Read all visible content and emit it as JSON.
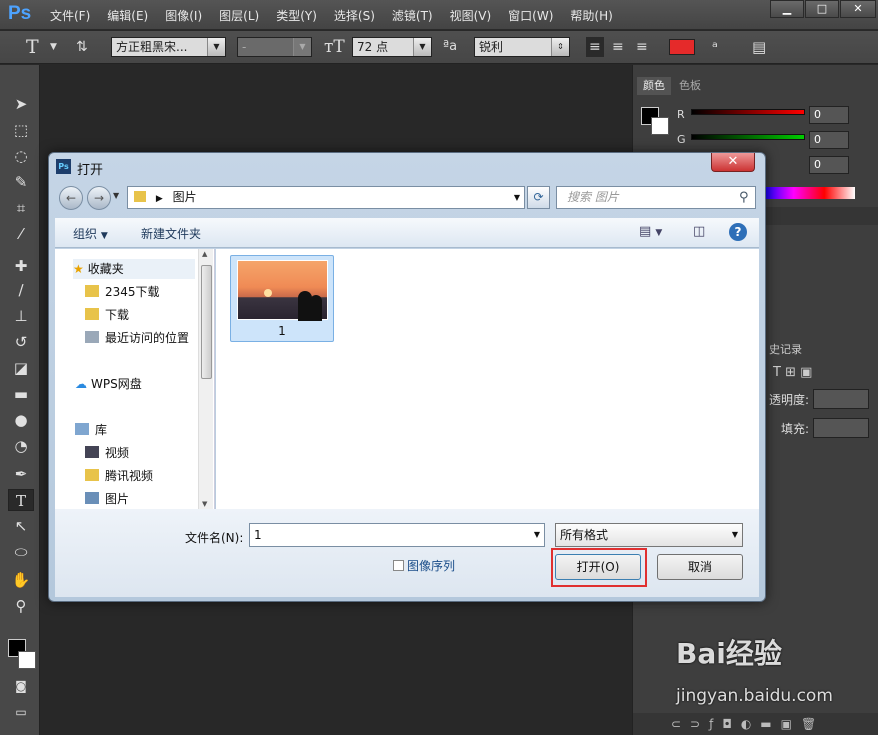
{
  "app": {
    "logo": "Ps"
  },
  "menubar": {
    "items": [
      "文件(F)",
      "编辑(E)",
      "图像(I)",
      "图层(L)",
      "类型(Y)",
      "选择(S)",
      "滤镜(T)",
      "视图(V)",
      "窗口(W)",
      "帮助(H)"
    ]
  },
  "window_buttons": {
    "minimize": "▁",
    "maximize": "□",
    "close": "✕"
  },
  "optionsbar": {
    "font_family": "方正粗黑宋...",
    "font_style": "-",
    "font_size": "72 点",
    "antialias": "锐利",
    "text_color": "#e52a2a"
  },
  "right_panel": {
    "tabs": [
      "颜色",
      "色板"
    ],
    "r_label": "R",
    "g_label": "G",
    "r_value": "0",
    "g_value": "0",
    "b_value": "0",
    "history_tab": "史记录",
    "opacity_label": "透明度:",
    "fill_label": "填充:"
  },
  "dialog": {
    "title": "打开",
    "path": "图片",
    "search_placeholder": "搜索 图片",
    "organize": "组织",
    "new_folder": "新建文件夹",
    "nav": {
      "favorites": "收藏夹",
      "fav_items": [
        "2345下载",
        "下载",
        "最近访问的位置"
      ],
      "wps": "WPS网盘",
      "library": "库",
      "lib_items": [
        "视频",
        "腾讯视频",
        "图片"
      ]
    },
    "file": {
      "name": "1"
    },
    "filename_label": "文件名(N):",
    "filename_value": "1",
    "format": "所有格式",
    "image_sequence": "图像序列",
    "open_button": "打开(O)",
    "cancel_button": "取消"
  },
  "watermark": {
    "brand": "Bai经验",
    "url": "jingyan.baidu.com"
  }
}
